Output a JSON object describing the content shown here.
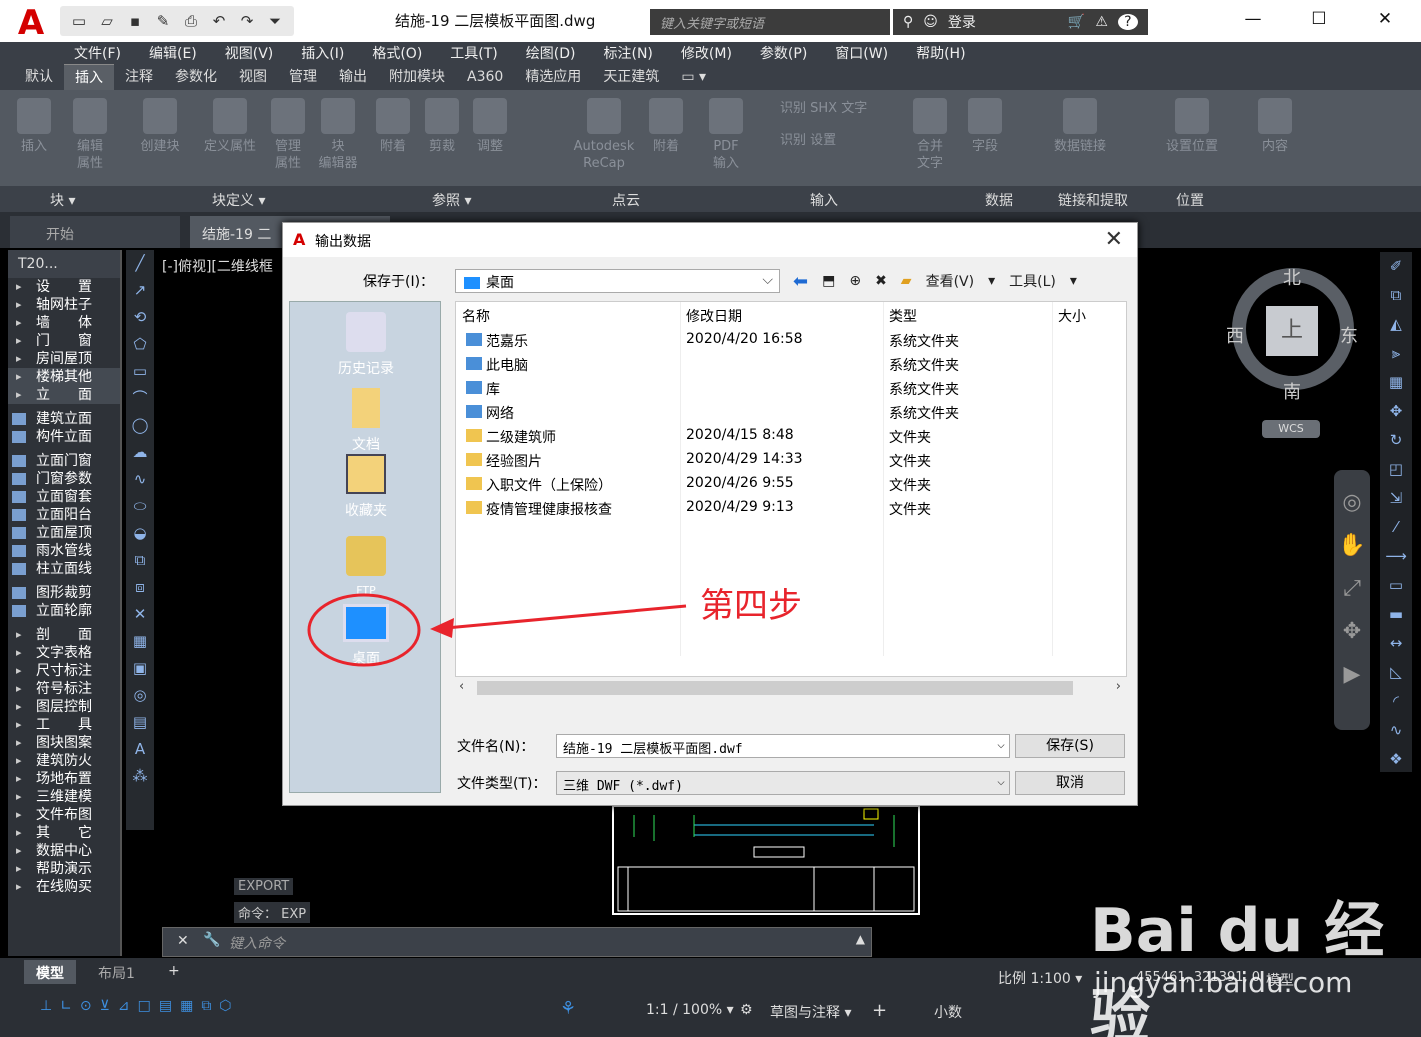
{
  "app": {
    "logo": "A",
    "title": "结施-19 二层模板平面图.dwg",
    "search_placeholder": "键入关键字或短语",
    "login": "登录",
    "help": "?"
  },
  "menu": [
    "文件(F)",
    "编辑(E)",
    "视图(V)",
    "插入(I)",
    "格式(O)",
    "工具(T)",
    "绘图(D)",
    "标注(N)",
    "修改(M)",
    "参数(P)",
    "窗口(W)",
    "帮助(H)"
  ],
  "ribbon_tabs": [
    "默认",
    "插入",
    "注释",
    "参数化",
    "视图",
    "管理",
    "输出",
    "附加模块",
    "A360",
    "精选应用",
    "天正建筑"
  ],
  "ribbon_active": "插入",
  "ribbon_buttons": [
    {
      "id": "insert",
      "label": "插入"
    },
    {
      "id": "edit-attr",
      "label": "编辑\n属性"
    },
    {
      "id": "create-block",
      "label": "创建块"
    },
    {
      "id": "define-attr",
      "label": "定义属性"
    },
    {
      "id": "manage-attr",
      "label": "管理\n属性"
    },
    {
      "id": "block-editor",
      "label": "块\n编辑器"
    },
    {
      "id": "attach",
      "label": "附着"
    },
    {
      "id": "clip",
      "label": "剪裁"
    },
    {
      "id": "adjust",
      "label": "调整"
    },
    {
      "id": "recap",
      "label": "Autodesk\nReCap"
    },
    {
      "id": "attach2",
      "label": "附着"
    },
    {
      "id": "pdf-import",
      "label": "PDF\n输入"
    },
    {
      "id": "merge-text",
      "label": "合并\n文字"
    },
    {
      "id": "field",
      "label": "字段"
    },
    {
      "id": "data-link",
      "label": "数据链接"
    },
    {
      "id": "set-location",
      "label": "设置位置"
    },
    {
      "id": "content",
      "label": "内容"
    }
  ],
  "ribbon_small": [
    "识别 SHX 文字",
    "识别 设置"
  ],
  "ribbon_panels": [
    "块 ▾",
    "块定义 ▾",
    "参照 ▾",
    "点云",
    "输入",
    "数据",
    "链接和提取",
    "位置"
  ],
  "doc_tabs": {
    "start": "开始",
    "file": "结施-19 二"
  },
  "t20": {
    "title": "T20...",
    "items": [
      {
        "label": "设　　置",
        "type": "arrow"
      },
      {
        "label": "轴网柱子",
        "type": "arrow"
      },
      {
        "label": "墙　　体",
        "type": "arrow"
      },
      {
        "label": "门　　窗",
        "type": "arrow"
      },
      {
        "label": "房间屋顶",
        "type": "arrow"
      },
      {
        "label": "楼梯其他",
        "type": "arrow",
        "hl": true
      },
      {
        "label": "立　　面",
        "type": "arrow",
        "hl": true
      },
      {
        "label": "建筑立面",
        "type": "sub"
      },
      {
        "label": "构件立面",
        "type": "sub"
      },
      {
        "label": "立面门窗",
        "type": "sub"
      },
      {
        "label": "门窗参数",
        "type": "sub"
      },
      {
        "label": "立面窗套",
        "type": "sub"
      },
      {
        "label": "立面阳台",
        "type": "sub"
      },
      {
        "label": "立面屋顶",
        "type": "sub"
      },
      {
        "label": "雨水管线",
        "type": "sub"
      },
      {
        "label": "柱立面线",
        "type": "sub"
      },
      {
        "label": "图形裁剪",
        "type": "sub"
      },
      {
        "label": "立面轮廓",
        "type": "sub"
      },
      {
        "label": "剖　　面",
        "type": "arrow"
      },
      {
        "label": "文字表格",
        "type": "arrow"
      },
      {
        "label": "尺寸标注",
        "type": "arrow"
      },
      {
        "label": "符号标注",
        "type": "arrow"
      },
      {
        "label": "图层控制",
        "type": "arrow"
      },
      {
        "label": "工　　具",
        "type": "arrow"
      },
      {
        "label": "图块图案",
        "type": "arrow"
      },
      {
        "label": "建筑防火",
        "type": "arrow"
      },
      {
        "label": "场地布置",
        "type": "arrow"
      },
      {
        "label": "三维建模",
        "type": "arrow"
      },
      {
        "label": "文件布图",
        "type": "arrow"
      },
      {
        "label": "其　　它",
        "type": "arrow"
      },
      {
        "label": "数据中心",
        "type": "arrow"
      },
      {
        "label": "帮助演示",
        "type": "arrow"
      },
      {
        "label": "在线购买",
        "type": "arrow"
      }
    ]
  },
  "viewport_label": "[-]俯视][二维线框",
  "navcube": {
    "north": "北",
    "south": "南",
    "east": "东",
    "west": "西",
    "top": "上",
    "wcs": "WCS"
  },
  "command": {
    "hist1": "EXPORT",
    "hist2": "命令： EXP",
    "placeholder": "键入命令"
  },
  "layout_tabs": [
    "模型",
    "布局1",
    "+"
  ],
  "status": {
    "scale": "比例 1:100 ▾",
    "coords": "455461, 321391, 0",
    "model": "模型",
    "draft": "草图与注释 ▾",
    "ratio": "1:1 / 100% ▾",
    "units": "小数"
  },
  "watermark": {
    "logo": "Bai du 经验",
    "url": "jingyan.baidu.com"
  },
  "dialog": {
    "title": "输出数据",
    "save_in_label": "保存于(I)：",
    "save_in": "桌面",
    "view_label": "查看(V)",
    "tools_label": "工具(L)",
    "places": [
      "历史记录",
      "文档",
      "收藏夹",
      "FTP",
      "桌面"
    ],
    "columns": [
      "名称",
      "修改日期",
      "类型",
      "大小"
    ],
    "files": [
      {
        "name": "范嘉乐",
        "date": "2020/4/20 16:58",
        "type": "系统文件夹"
      },
      {
        "name": "此电脑",
        "date": "",
        "type": "系统文件夹"
      },
      {
        "name": "库",
        "date": "",
        "type": "系统文件夹"
      },
      {
        "name": "网络",
        "date": "",
        "type": "系统文件夹"
      },
      {
        "name": "二级建筑师",
        "date": "2020/4/15 8:48",
        "type": "文件夹"
      },
      {
        "name": "经验图片",
        "date": "2020/4/29 14:33",
        "type": "文件夹"
      },
      {
        "name": "入职文件（上保险）",
        "date": "2020/4/26 9:55",
        "type": "文件夹"
      },
      {
        "name": "疫情管理健康报核查",
        "date": "2020/4/29 9:13",
        "type": "文件夹"
      }
    ],
    "filename_label": "文件名(N)：",
    "filename": "结施-19 二层模板平面图.dwf",
    "filetype_label": "文件类型(T)：",
    "filetype": "三维 DWF (*.dwf)",
    "save": "保存(S)",
    "cancel": "取消"
  },
  "annotation": "第四步"
}
